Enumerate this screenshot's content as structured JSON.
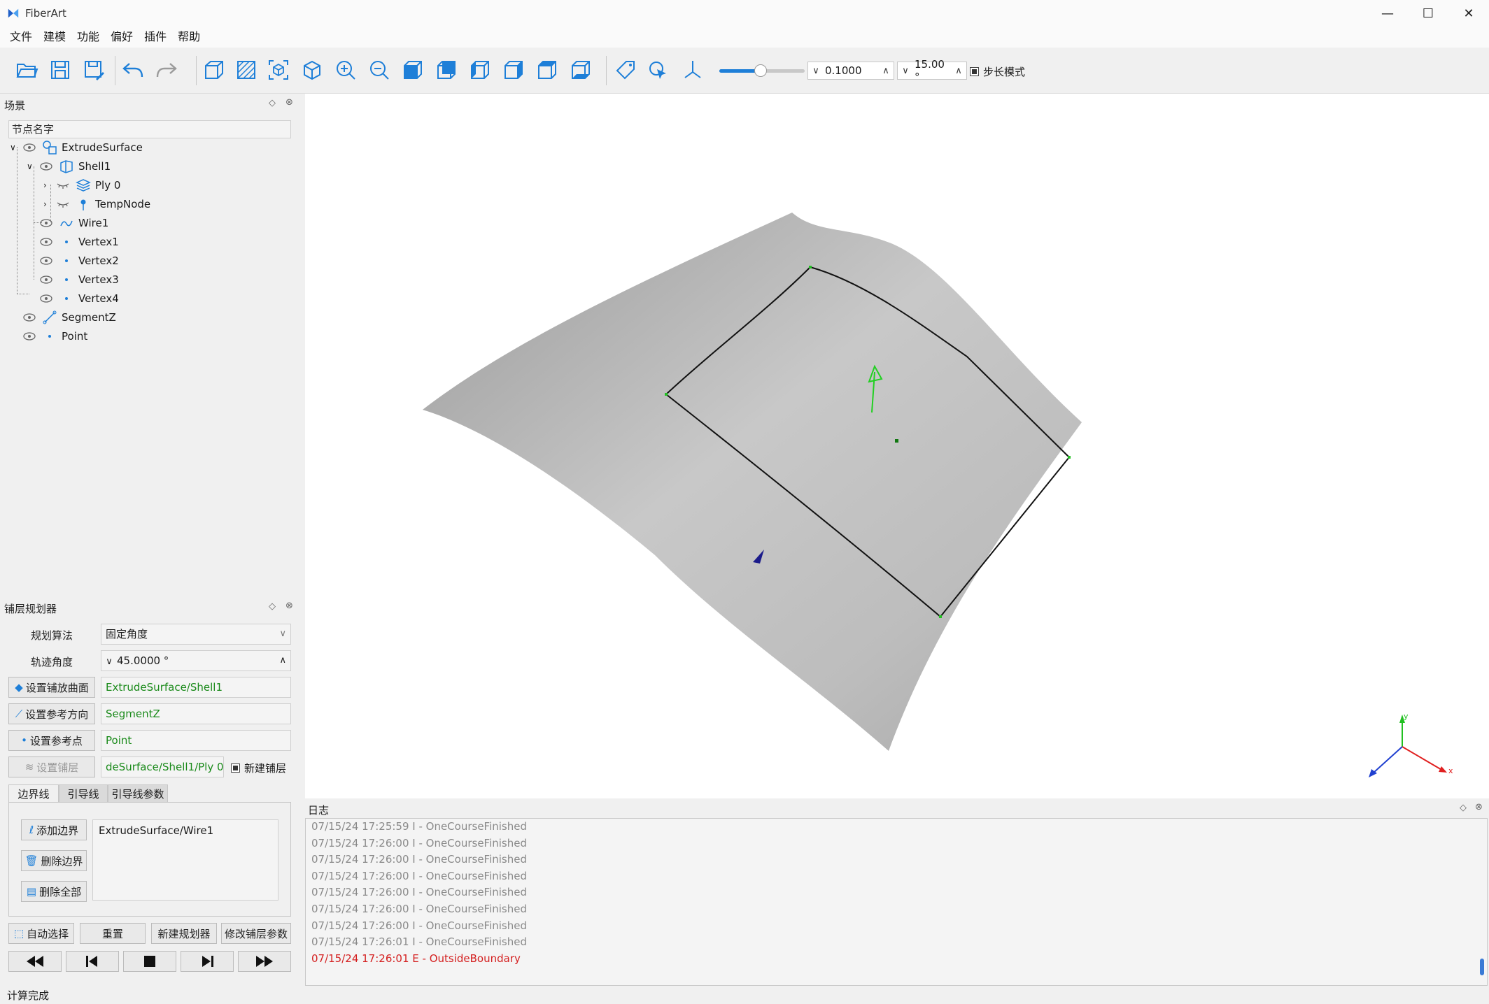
{
  "window": {
    "title": "FiberArt"
  },
  "menu": [
    "文件",
    "建模",
    "功能",
    "偏好",
    "插件",
    "帮助"
  ],
  "toolbar": {
    "step_value": "0.1000",
    "angle_value": "15.00 °",
    "step_mode_label": "步长模式",
    "step_mode_checked": true,
    "slider_fraction": 0.48
  },
  "scene": {
    "title": "场景",
    "filter_placeholder": "节点名字",
    "nodes": [
      {
        "label": "ExtrudeSurface"
      },
      {
        "label": "Shell1"
      },
      {
        "label": "Ply 0"
      },
      {
        "label": "TempNode"
      },
      {
        "label": "Wire1"
      },
      {
        "label": "Vertex1"
      },
      {
        "label": "Vertex2"
      },
      {
        "label": "Vertex3"
      },
      {
        "label": "Vertex4"
      },
      {
        "label": "SegmentZ"
      },
      {
        "label": "Point"
      }
    ]
  },
  "axis_labels": {
    "x": "x",
    "y": "y"
  },
  "planner": {
    "title": "铺层规划器",
    "algorithm_label": "规划算法",
    "algorithm_value": "固定角度",
    "angle_label": "轨迹角度",
    "angle_value": "45.0000 °",
    "set_surface_label": "设置铺放曲面",
    "surface_value": "ExtrudeSurface/Shell1",
    "set_direction_label": "设置参考方向",
    "direction_value": "SegmentZ",
    "set_point_label": "设置参考点",
    "point_value": "Point",
    "set_ply_label": "设置铺层",
    "ply_value": "deSurface/Shell1/Ply 0",
    "new_ply_label": "新建铺层",
    "new_ply_checked": true,
    "tabs": [
      "边界线",
      "引导线",
      "引导线参数"
    ],
    "add_boundary_label": "添加边界",
    "delete_boundary_label": "删除边界",
    "delete_all_label": "删除全部",
    "boundary_items": [
      "ExtrudeSurface/Wire1"
    ],
    "auto_select_label": "自动选择",
    "reset_label": "重置",
    "new_planner_label": "新建规划器",
    "modify_params_label": "修改铺层参数"
  },
  "log": {
    "title": "日志",
    "lines": [
      {
        "text": "07/15/24 17:25:59 I - OneCourseFinished",
        "level": "info"
      },
      {
        "text": "07/15/24 17:26:00 I - OneCourseFinished",
        "level": "info"
      },
      {
        "text": "07/15/24 17:26:00 I - OneCourseFinished",
        "level": "info"
      },
      {
        "text": "07/15/24 17:26:00 I - OneCourseFinished",
        "level": "info"
      },
      {
        "text": "07/15/24 17:26:00 I - OneCourseFinished",
        "level": "info"
      },
      {
        "text": "07/15/24 17:26:00 I - OneCourseFinished",
        "level": "info"
      },
      {
        "text": "07/15/24 17:26:00 I - OneCourseFinished",
        "level": "info"
      },
      {
        "text": "07/15/24 17:26:01 I - OneCourseFinished",
        "level": "info"
      },
      {
        "text": "07/15/24 17:26:01 E - OutsideBoundary",
        "level": "error"
      }
    ]
  },
  "status": {
    "text": "计算完成"
  },
  "colors": {
    "accent": "#1e7fd8",
    "green_text": "#1a8a1a",
    "error": "#d42020",
    "surface": "#c4c4c4"
  }
}
